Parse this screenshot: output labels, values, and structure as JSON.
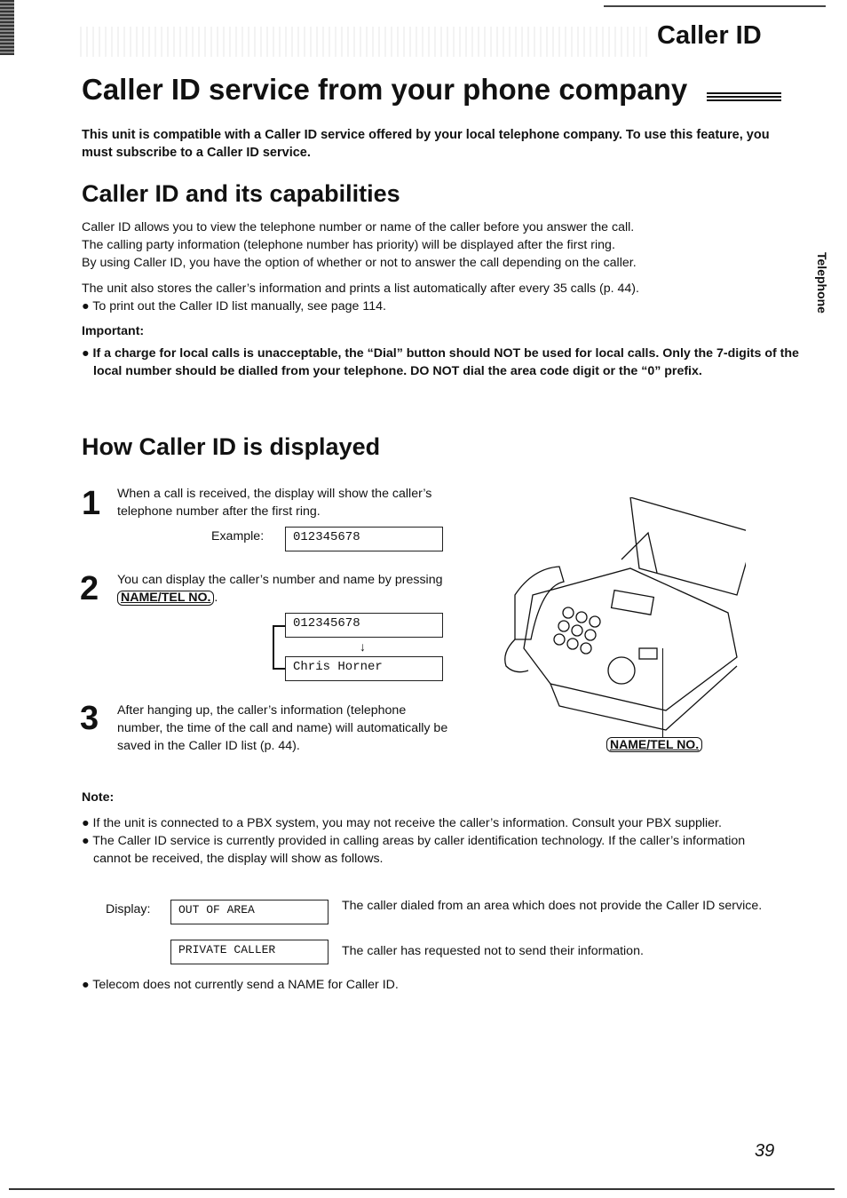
{
  "header": {
    "section_tag": "Caller ID",
    "page_title": "Caller ID service from your phone company"
  },
  "intro": "This unit is compatible with a Caller ID service offered by your local telephone company. To use this feature, you must subscribe to a Caller ID service.",
  "capabilities": {
    "heading": "Caller ID and its capabilities",
    "paragraph1_lines": [
      "Caller ID allows you to view the telephone number or name of the caller before you answer the call.",
      "The calling party information (telephone number has priority) will be displayed after the first ring.",
      "By using Caller ID, you have the option of whether or not to answer the call depending on the caller."
    ],
    "paragraph2": "The unit also stores the caller’s information and prints a list automatically after every 35 calls (p. 44).",
    "bullet": "To print out the Caller ID list manually, see page 114.",
    "important_label": "Important:",
    "important_text": "If a charge for local calls is unacceptable, the “Dial” button should NOT be used for local calls. Only the 7-digits of the local number should be dialled from your telephone. DO NOT dial the area code digit or the “0” prefix."
  },
  "how_displayed": {
    "heading": "How Caller ID is displayed",
    "steps": [
      {
        "number": "1",
        "text": "When a call is received, the display will show the caller’s telephone number after the first ring."
      },
      {
        "number": "2",
        "text_before": "You can display the caller’s number and name by pressing",
        "key": "NAME/TEL NO.",
        "text_after": "."
      },
      {
        "number": "3",
        "text": "After hanging up, the caller’s information (telephone number, the time of the call and name) will automatically be saved in the Caller ID list (p. 44)."
      }
    ],
    "example_label": "Example:",
    "example_display": "012345678",
    "toggle_display_number": "012345678",
    "toggle_display_name": "Chris Horner",
    "illustration_callout": "NAME/TEL NO."
  },
  "note": {
    "label": "Note:",
    "bullets": [
      "If the unit is connected to a PBX system, you may not receive the caller’s information. Consult your PBX supplier.",
      "The Caller ID service is currently provided in calling areas by caller identification technology. If the caller’s information cannot be received, the display will show as follows."
    ],
    "display_label": "Display:",
    "displays": [
      {
        "lcd": "OUT OF AREA",
        "desc": "The caller dialed from an area which does not provide the Caller ID service."
      },
      {
        "lcd": "PRIVATE CALLER",
        "desc": "The caller has requested not to send their information."
      }
    ],
    "final_bullet": "Telecom does not currently send a NAME for Caller ID."
  },
  "side_tab": "Telephone",
  "page_number": "39"
}
